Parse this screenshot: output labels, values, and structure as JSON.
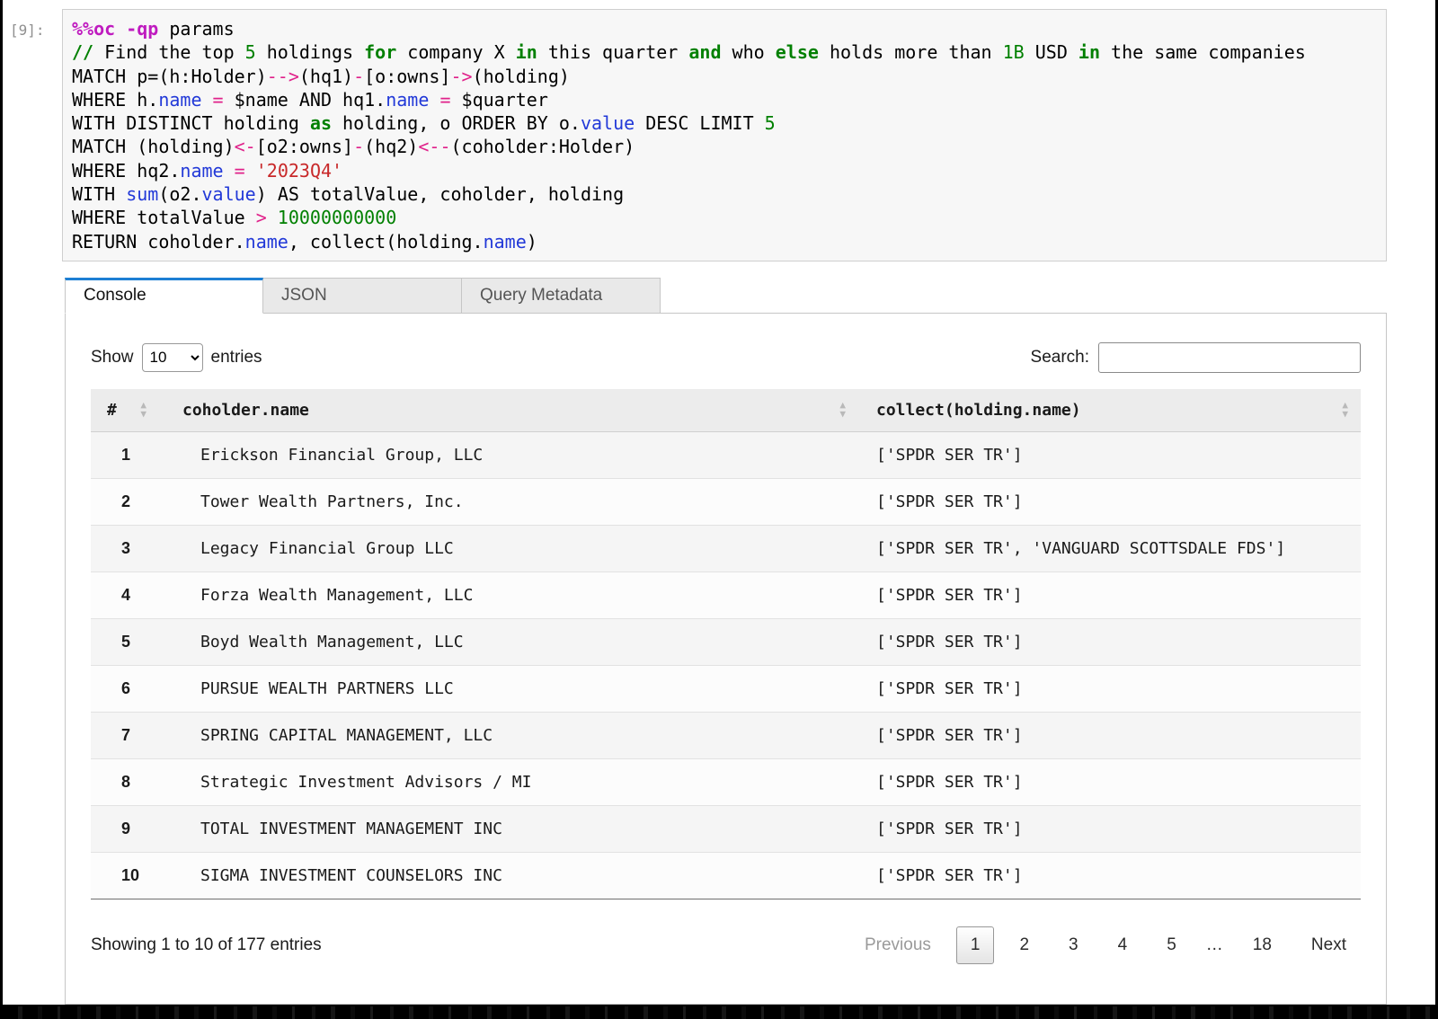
{
  "cell": {
    "prompt": "[9]:",
    "code": [
      [
        {
          "t": "%%oc",
          "c": "mg"
        },
        {
          "t": " ",
          "c": "pl"
        },
        {
          "t": "-qp",
          "c": "mg"
        },
        {
          "t": " params",
          "c": "pl"
        }
      ],
      [
        {
          "t": "//",
          "c": "kw"
        },
        {
          "t": " Find the top ",
          "c": "pl"
        },
        {
          "t": "5",
          "c": "nb"
        },
        {
          "t": " holdings ",
          "c": "pl"
        },
        {
          "t": "for",
          "c": "kw"
        },
        {
          "t": " company X ",
          "c": "pl"
        },
        {
          "t": "in",
          "c": "kw"
        },
        {
          "t": " this quarter ",
          "c": "pl"
        },
        {
          "t": "and",
          "c": "kw"
        },
        {
          "t": " who ",
          "c": "pl"
        },
        {
          "t": "else",
          "c": "kw"
        },
        {
          "t": " holds more than ",
          "c": "pl"
        },
        {
          "t": "1B",
          "c": "nb"
        },
        {
          "t": " USD ",
          "c": "pl"
        },
        {
          "t": "in",
          "c": "kw"
        },
        {
          "t": " the same companies",
          "c": "pl"
        }
      ],
      [
        {
          "t": "MATCH p=(h:Holder)",
          "c": "pl"
        },
        {
          "t": "-->",
          "c": "op"
        },
        {
          "t": "(hq1)",
          "c": "pl"
        },
        {
          "t": "-",
          "c": "op"
        },
        {
          "t": "[o:owns]",
          "c": "pl"
        },
        {
          "t": "->",
          "c": "op"
        },
        {
          "t": "(holding)",
          "c": "pl"
        }
      ],
      [
        {
          "t": "WHERE h.",
          "c": "pl"
        },
        {
          "t": "name",
          "c": "pr"
        },
        {
          "t": " ",
          "c": "pl"
        },
        {
          "t": "=",
          "c": "op"
        },
        {
          "t": " $name AND hq1.",
          "c": "pl"
        },
        {
          "t": "name",
          "c": "pr"
        },
        {
          "t": " ",
          "c": "pl"
        },
        {
          "t": "=",
          "c": "op"
        },
        {
          "t": " $quarter",
          "c": "pl"
        }
      ],
      [
        {
          "t": "WITH DISTINCT holding ",
          "c": "pl"
        },
        {
          "t": "as",
          "c": "kw"
        },
        {
          "t": " holding, o ORDER BY o.",
          "c": "pl"
        },
        {
          "t": "value",
          "c": "pr"
        },
        {
          "t": " DESC LIMIT ",
          "c": "pl"
        },
        {
          "t": "5",
          "c": "nb"
        }
      ],
      [
        {
          "t": "MATCH (holding)",
          "c": "pl"
        },
        {
          "t": "<-",
          "c": "op"
        },
        {
          "t": "[o2:owns]",
          "c": "pl"
        },
        {
          "t": "-",
          "c": "op"
        },
        {
          "t": "(hq2)",
          "c": "pl"
        },
        {
          "t": "<--",
          "c": "op"
        },
        {
          "t": "(coholder:Holder)",
          "c": "pl"
        }
      ],
      [
        {
          "t": "WHERE hq2.",
          "c": "pl"
        },
        {
          "t": "name",
          "c": "pr"
        },
        {
          "t": " ",
          "c": "pl"
        },
        {
          "t": "=",
          "c": "op"
        },
        {
          "t": " ",
          "c": "pl"
        },
        {
          "t": "'2023Q4'",
          "c": "st"
        }
      ],
      [
        {
          "t": "WITH ",
          "c": "pl"
        },
        {
          "t": "sum",
          "c": "fn"
        },
        {
          "t": "(o2.",
          "c": "pl"
        },
        {
          "t": "value",
          "c": "pr"
        },
        {
          "t": ") AS totalValue, coholder, holding",
          "c": "pl"
        }
      ],
      [
        {
          "t": "WHERE totalValue ",
          "c": "pl"
        },
        {
          "t": ">",
          "c": "op"
        },
        {
          "t": " ",
          "c": "pl"
        },
        {
          "t": "10000000000",
          "c": "nb"
        }
      ],
      [
        {
          "t": "RETURN coholder.",
          "c": "pl"
        },
        {
          "t": "name",
          "c": "pr"
        },
        {
          "t": ", collect(holding.",
          "c": "pl"
        },
        {
          "t": "name",
          "c": "pr"
        },
        {
          "t": ")",
          "c": "pl"
        }
      ]
    ]
  },
  "tabs": [
    {
      "label": "Console",
      "active": true
    },
    {
      "label": "JSON",
      "active": false
    },
    {
      "label": "Query Metadata",
      "active": false
    }
  ],
  "toolbar": {
    "show_label": "Show",
    "entries_label": "entries",
    "page_size": "10",
    "search_label": "Search:",
    "search_value": ""
  },
  "table": {
    "headers": [
      "#",
      "coholder.name",
      "collect(holding.name)"
    ],
    "rows": [
      [
        "1",
        "Erickson Financial Group, LLC",
        "['SPDR SER TR']"
      ],
      [
        "2",
        "Tower Wealth Partners, Inc.",
        "['SPDR SER TR']"
      ],
      [
        "3",
        "Legacy Financial Group LLC",
        "['SPDR SER TR', 'VANGUARD SCOTTSDALE FDS']"
      ],
      [
        "4",
        "Forza Wealth Management, LLC",
        "['SPDR SER TR']"
      ],
      [
        "5",
        "Boyd Wealth Management, LLC",
        "['SPDR SER TR']"
      ],
      [
        "6",
        "PURSUE WEALTH PARTNERS LLC",
        "['SPDR SER TR']"
      ],
      [
        "7",
        "SPRING CAPITAL MANAGEMENT, LLC",
        "['SPDR SER TR']"
      ],
      [
        "8",
        "Strategic Investment Advisors / MI",
        "['SPDR SER TR']"
      ],
      [
        "9",
        "TOTAL INVESTMENT MANAGEMENT INC",
        "['SPDR SER TR']"
      ],
      [
        "10",
        "SIGMA INVESTMENT COUNSELORS INC",
        "['SPDR SER TR']"
      ]
    ]
  },
  "footer": {
    "info": "Showing 1 to 10 of 177 entries",
    "pagination": [
      {
        "label": "Previous",
        "state": "disabled"
      },
      {
        "label": "1",
        "state": "current"
      },
      {
        "label": "2",
        "state": "normal"
      },
      {
        "label": "3",
        "state": "normal"
      },
      {
        "label": "4",
        "state": "normal"
      },
      {
        "label": "5",
        "state": "normal"
      },
      {
        "label": "…",
        "state": "ellipsis"
      },
      {
        "label": "18",
        "state": "normal"
      },
      {
        "label": "Next",
        "state": "normal"
      }
    ]
  }
}
